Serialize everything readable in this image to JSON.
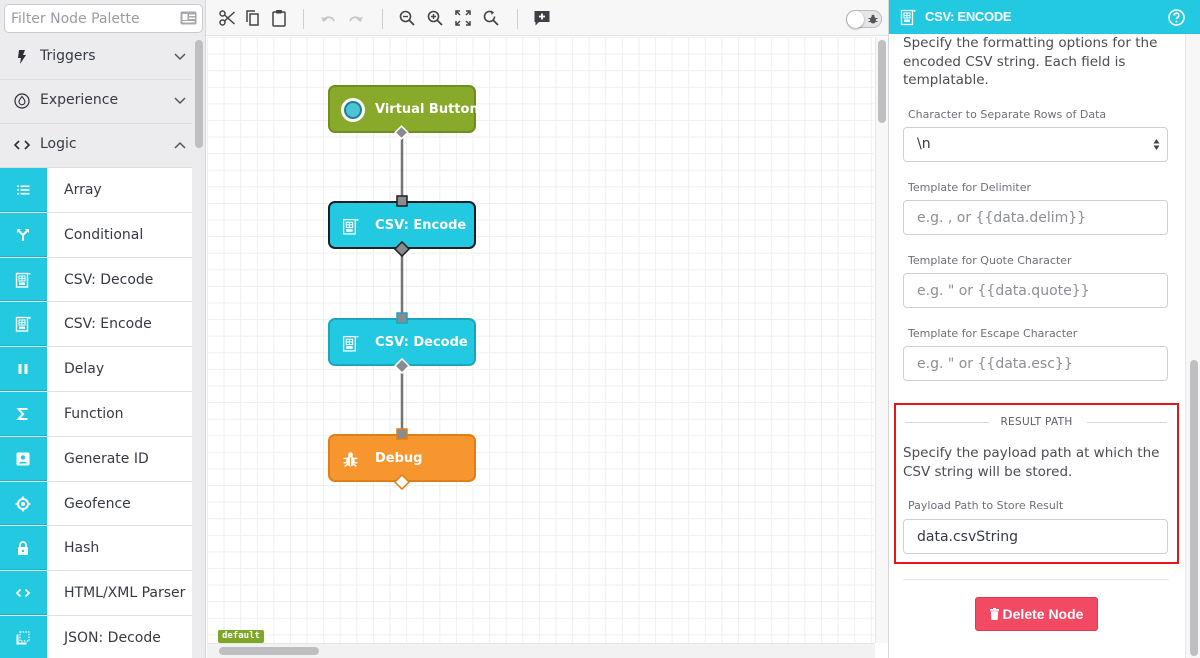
{
  "palette": {
    "filter_placeholder": "Filter Node Palette",
    "categories": [
      {
        "label": "Triggers",
        "icon": "bolt-icon",
        "expanded": false
      },
      {
        "label": "Experience",
        "icon": "drop-icon",
        "expanded": false
      },
      {
        "label": "Logic",
        "icon": "code-icon",
        "expanded": true
      }
    ],
    "nodes": [
      {
        "label": "Array",
        "icon": "list-icon"
      },
      {
        "label": "Conditional",
        "icon": "branch-icon"
      },
      {
        "label": "CSV: Decode",
        "icon": "csv-decode-icon"
      },
      {
        "label": "CSV: Encode",
        "icon": "csv-encode-icon"
      },
      {
        "label": "Delay",
        "icon": "pause-icon"
      },
      {
        "label": "Function",
        "icon": "sigma-icon"
      },
      {
        "label": "Generate ID",
        "icon": "id-card-icon"
      },
      {
        "label": "Geofence",
        "icon": "crosshair-icon"
      },
      {
        "label": "Hash",
        "icon": "lock-icon"
      },
      {
        "label": "HTML/XML Parser",
        "icon": "code-icon"
      },
      {
        "label": "JSON: Decode",
        "icon": "json-decode-icon"
      }
    ],
    "accent_color": "#23c8e1"
  },
  "toolbar": {
    "buttons": [
      "cut",
      "copy",
      "paste",
      "undo",
      "redo",
      "zoom-out",
      "zoom-in",
      "fit-to-screen",
      "reset-zoom",
      "add-comment"
    ],
    "undo_enabled": false,
    "redo_enabled": false,
    "debug_toggle_on": false
  },
  "canvas": {
    "version_label": "default",
    "nodes": [
      {
        "label": "Virtual Button",
        "type": "trigger",
        "color": "#88a92a"
      },
      {
        "label": "CSV: Encode",
        "type": "logic",
        "color": "#23c8e1",
        "selected": true
      },
      {
        "label": "CSV: Decode",
        "type": "logic",
        "color": "#23c8e1"
      },
      {
        "label": "Debug",
        "type": "output",
        "color": "#f7962f"
      }
    ]
  },
  "panel": {
    "title": "CSV: ENCODE",
    "intro": "Specify the formatting options for the encoded CSV string. Each field is templatable.",
    "fields": {
      "row_separator": {
        "label": "Character to Separate Rows of Data",
        "value": "\\n"
      },
      "delimiter": {
        "label": "Template for Delimiter",
        "placeholder": "e.g. , or {{data.delim}}",
        "value": ""
      },
      "quote": {
        "label": "Template for Quote Character",
        "placeholder": "e.g. \" or {{data.quote}}",
        "value": ""
      },
      "escape": {
        "label": "Template for Escape Character",
        "placeholder": "e.g. \" or {{data.esc}}",
        "value": ""
      }
    },
    "result_path": {
      "section_title": "RESULT PATH",
      "description": "Specify the payload path at which the CSV string will be stored.",
      "label": "Payload Path to Store Result",
      "value": "data.csvString"
    },
    "delete_label": "Delete Node",
    "delete_color": "#f34a63"
  }
}
